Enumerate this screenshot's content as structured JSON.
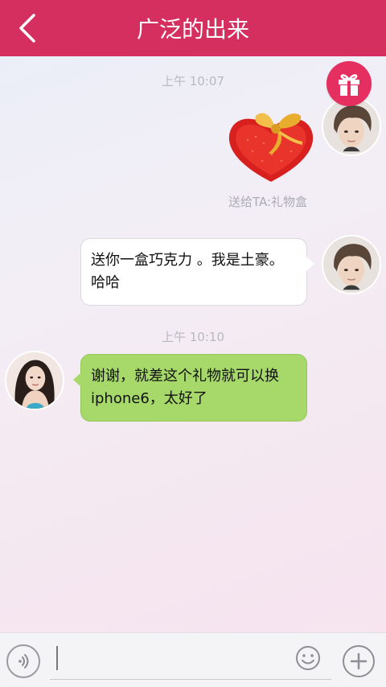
{
  "header": {
    "title": "广泛的出来",
    "back_icon": "chevron-left-icon",
    "background": "#d42f5f"
  },
  "gift_button": {
    "icon": "gift-icon",
    "color": "#e52f61"
  },
  "messages": [
    {
      "type": "timestamp",
      "text": "上午 10:07"
    },
    {
      "type": "gift",
      "sender": "self",
      "image": "heart-gift-box",
      "caption": "送给TA:礼物盒"
    },
    {
      "type": "text",
      "sender": "self",
      "text": "送你一盒巧克力 。我是土豪。哈哈",
      "bubble_color": "#ffffff"
    },
    {
      "type": "timestamp",
      "text": "上午 10:10"
    },
    {
      "type": "text",
      "sender": "other",
      "text": "谢谢，就差这个礼物就可以换iphone6，太好了",
      "bubble_color": "#a6d86a"
    }
  ],
  "input_bar": {
    "voice_icon": "voice-icon",
    "text_value": "",
    "emoji_icon": "emoji-icon",
    "plus_icon": "plus-icon"
  }
}
